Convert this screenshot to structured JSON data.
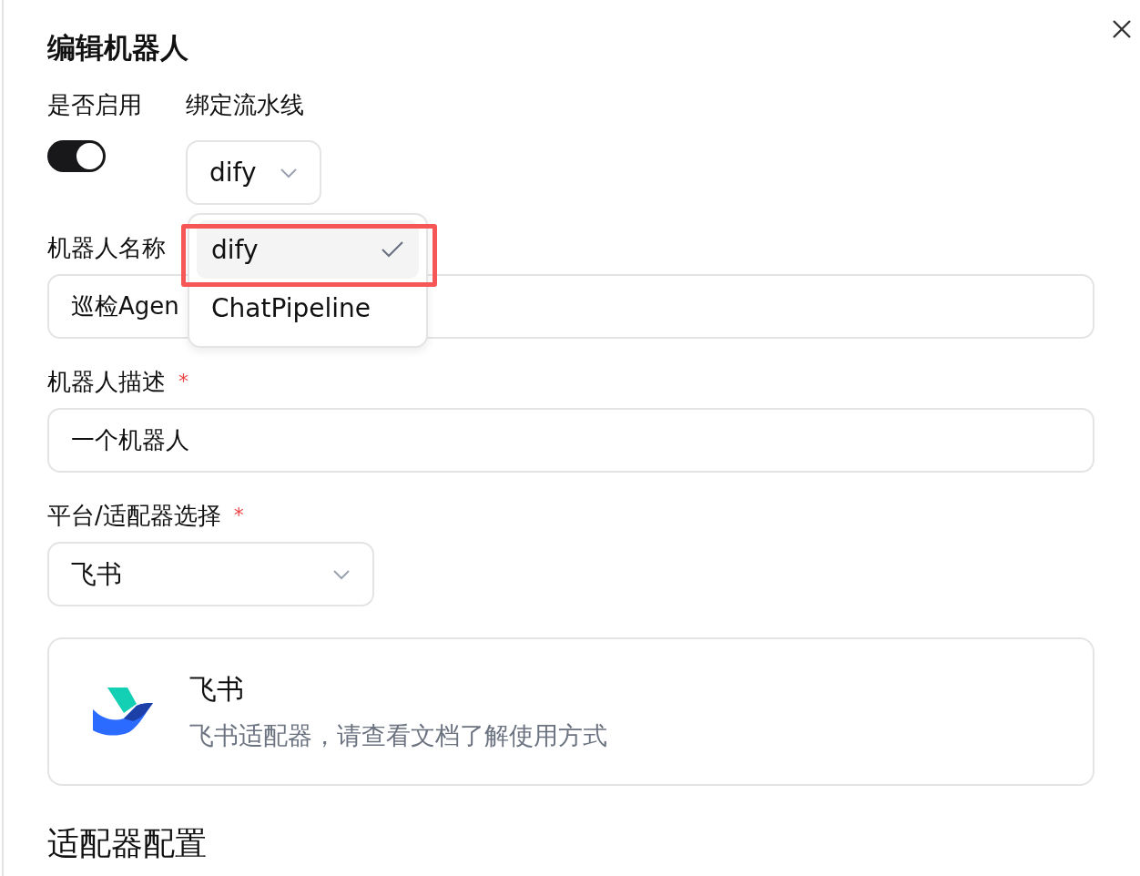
{
  "title": "编辑机器人",
  "enable": {
    "label": "是否启用",
    "on": true
  },
  "pipeline": {
    "label": "绑定流水线",
    "value": "dify",
    "expanded": true,
    "options": [
      {
        "label": "dify",
        "selected": true,
        "highlighted": true
      },
      {
        "label": "ChatPipeline",
        "selected": false,
        "highlighted": false
      }
    ]
  },
  "name": {
    "label": "机器人名称",
    "value": "巡检Agen"
  },
  "description": {
    "label": "机器人描述",
    "required_mark": "*",
    "value": "一个机器人"
  },
  "platform": {
    "label": "平台/适配器选择",
    "required_mark": "*",
    "value": "飞书"
  },
  "adapter_card": {
    "title": "飞书",
    "description": "飞书适配器，请查看文档了解使用方式"
  },
  "section_title": "适配器配置"
}
